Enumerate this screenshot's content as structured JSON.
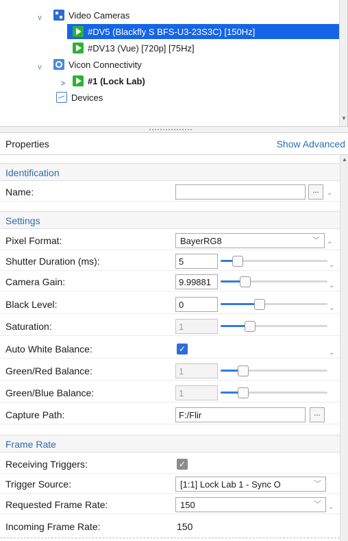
{
  "tree": {
    "items": [
      {
        "label": "Video Cameras",
        "expander": "v"
      },
      {
        "label": "#DV5 (Blackfly S BFS-U3-23S3C) [150Hz]"
      },
      {
        "label": "#DV13 (Vue) [720p] [75Hz]"
      },
      {
        "label": "Vicon Connectivity",
        "expander": "v"
      },
      {
        "label": "#1 (Lock Lab)",
        "expander": ">"
      },
      {
        "label": "Devices"
      }
    ]
  },
  "properties": {
    "title": "Properties",
    "show_advanced": "Show Advanced"
  },
  "sections": {
    "identification": "Identification",
    "settings": "Settings",
    "frame_rate": "Frame Rate"
  },
  "fields": {
    "name": {
      "label": "Name:",
      "value": ""
    },
    "pixel_format": {
      "label": "Pixel Format:",
      "value": "BayerRG8"
    },
    "shutter_duration": {
      "label": "Shutter Duration (ms):",
      "value": "5",
      "slider": 0.12
    },
    "camera_gain": {
      "label": "Camera Gain:",
      "value": "9.99881",
      "slider": 0.2
    },
    "black_level": {
      "label": "Black Level:",
      "value": "0",
      "slider": 0.35
    },
    "saturation": {
      "label": "Saturation:",
      "value": "1",
      "slider": 0.25
    },
    "auto_white_balance": {
      "label": "Auto White Balance:",
      "checked": true
    },
    "green_red_balance": {
      "label": "Green/Red Balance:",
      "value": "1",
      "slider": 0.18
    },
    "green_blue_balance": {
      "label": "Green/Blue Balance:",
      "value": "1",
      "slider": 0.18
    },
    "capture_path": {
      "label": "Capture Path:",
      "value": "F:/Flir"
    },
    "receiving_triggers": {
      "label": "Receiving Triggers:",
      "checked": true
    },
    "trigger_source": {
      "label": "Trigger Source:",
      "value": "[1:1] Lock Lab 1 - Sync O"
    },
    "requested_frame_rate": {
      "label": "Requested Frame Rate:",
      "value": "150"
    },
    "incoming_frame_rate": {
      "label": "Incoming Frame Rate:",
      "value": "150"
    }
  },
  "glyphs": {
    "ellipsis": "...",
    "caret": "⌄",
    "check": "✓",
    "dropdown": "﹀"
  },
  "colors": {
    "selection": "#1565e8",
    "section_text": "#2f6aa8",
    "link": "#2a6eb8",
    "slider_fill": "#2f7ce2"
  }
}
